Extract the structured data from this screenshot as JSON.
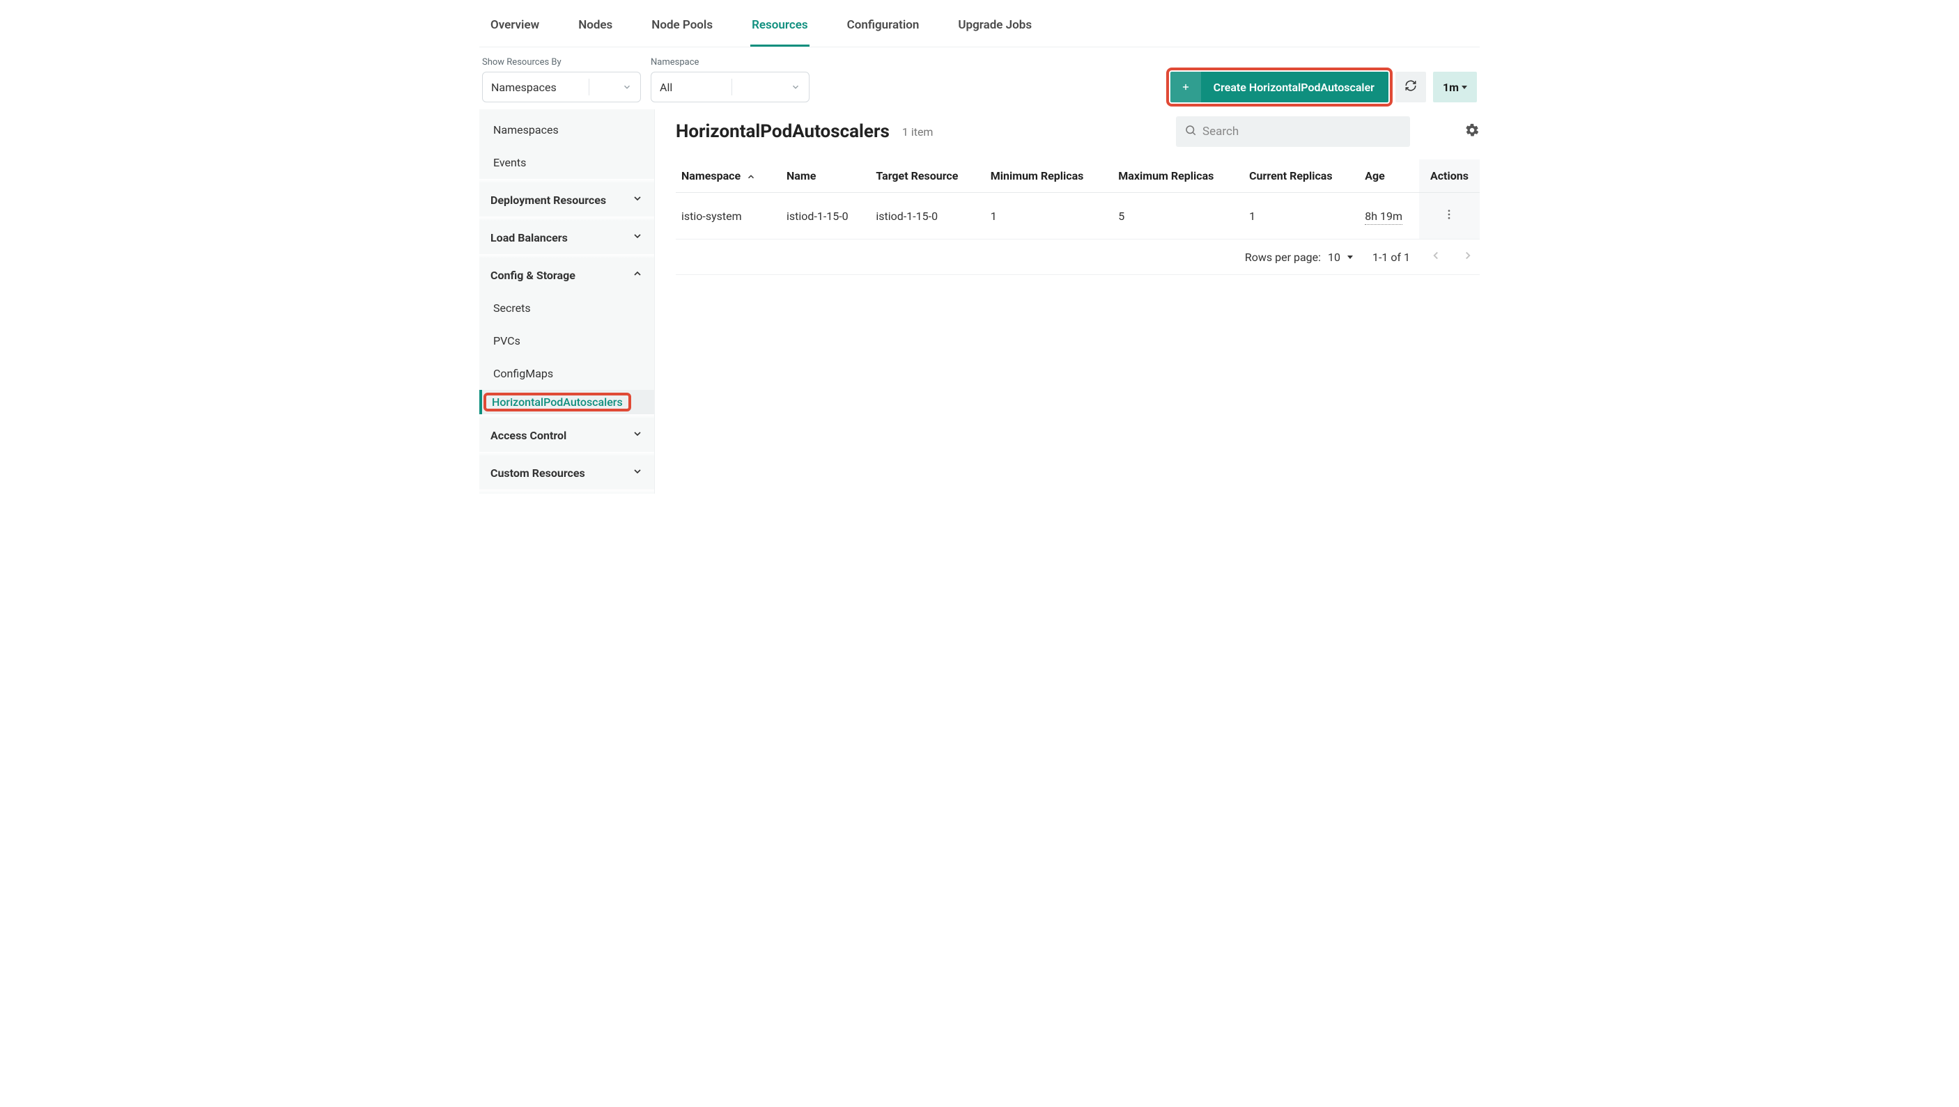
{
  "tabs": [
    {
      "label": "Overview"
    },
    {
      "label": "Nodes"
    },
    {
      "label": "Node Pools"
    },
    {
      "label": "Resources",
      "active": true
    },
    {
      "label": "Configuration"
    },
    {
      "label": "Upgrade Jobs"
    }
  ],
  "filters": {
    "show_by_label": "Show Resources By",
    "show_by_value": "Namespaces",
    "namespace_label": "Namespace",
    "namespace_value": "All"
  },
  "toolbar": {
    "create_label": "Create HorizontalPodAutoscaler",
    "interval_label": "1m"
  },
  "sidebar": {
    "simple": [
      {
        "label": "Namespaces"
      },
      {
        "label": "Events"
      }
    ],
    "groups": [
      {
        "label": "Deployment Resources",
        "expanded": false
      },
      {
        "label": "Load Balancers",
        "expanded": false
      },
      {
        "label": "Config & Storage",
        "expanded": true,
        "items": [
          {
            "label": "Secrets"
          },
          {
            "label": "PVCs"
          },
          {
            "label": "ConfigMaps"
          },
          {
            "label": "HorizontalPodAutoscalers",
            "active": true
          }
        ]
      },
      {
        "label": "Access Control",
        "expanded": false
      },
      {
        "label": "Custom Resources",
        "expanded": false
      }
    ]
  },
  "content": {
    "title": "HorizontalPodAutoscalers",
    "item_count_text": "1 item",
    "search_placeholder": "Search",
    "columns": [
      "Namespace",
      "Name",
      "Target Resource",
      "Minimum Replicas",
      "Maximum Replicas",
      "Current Replicas",
      "Age",
      "Actions"
    ],
    "rows": [
      {
        "namespace": "istio-system",
        "name": "istiod-1-15-0",
        "target": "istiod-1-15-0",
        "min": "1",
        "max": "5",
        "current": "1",
        "age": "8h 19m"
      }
    ],
    "pagination": {
      "rows_per_page_label": "Rows per page:",
      "rows_per_page_value": "10",
      "range_text": "1-1 of 1"
    }
  }
}
